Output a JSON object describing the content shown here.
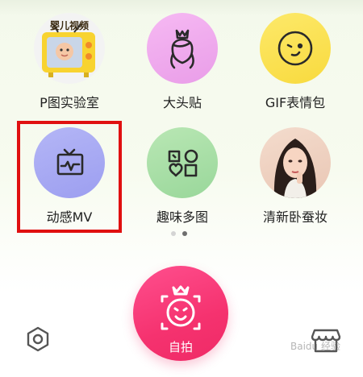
{
  "features": [
    {
      "label": "P图实验室",
      "icon": "baby-video-tv-icon",
      "badge": "婴儿视频"
    },
    {
      "label": "大头贴",
      "icon": "face-crown-icon"
    },
    {
      "label": "GIF表情包",
      "icon": "wink-emoji-icon"
    },
    {
      "label": "动感MV",
      "icon": "tv-wave-icon"
    },
    {
      "label": "趣味多图",
      "icon": "shapes-collage-icon"
    },
    {
      "label": "清新卧蚕妆",
      "icon": "portrait-model-icon"
    }
  ],
  "pager": {
    "active_index": 1,
    "total": 2
  },
  "capture": {
    "label": "自拍"
  },
  "colors": {
    "highlight": "#e01010",
    "capture": "#f5326f",
    "pink_circle": "#f0a8ee",
    "yellow_circle": "#fbe45a",
    "purple_circle": "#a9aaf3",
    "green_circle": "#a7dfa6"
  },
  "watermark": "Baidu 经验"
}
